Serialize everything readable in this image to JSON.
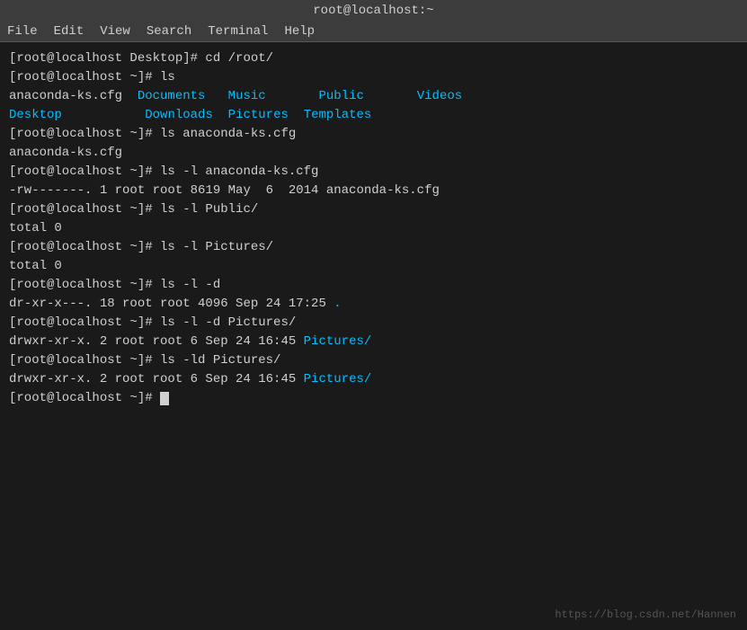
{
  "titleBar": {
    "title": "root@localhost:~"
  },
  "menuBar": {
    "items": [
      "File",
      "Edit",
      "View",
      "Search",
      "Terminal",
      "Help"
    ]
  },
  "terminal": {
    "lines": [
      {
        "type": "command",
        "text": "[root@localhost Desktop]# cd /root/"
      },
      {
        "type": "command",
        "text": "[root@localhost ~]# ls"
      },
      {
        "type": "ls_output_1",
        "parts": [
          {
            "text": "anaconda-ks.cfg  ",
            "color": "white"
          },
          {
            "text": "Documents",
            "color": "cyan"
          },
          {
            "text": "   ",
            "color": "white"
          },
          {
            "text": "Music",
            "color": "cyan"
          },
          {
            "text": "       ",
            "color": "white"
          },
          {
            "text": "Public",
            "color": "cyan"
          },
          {
            "text": "       ",
            "color": "white"
          },
          {
            "text": "Videos",
            "color": "cyan"
          }
        ]
      },
      {
        "type": "ls_output_2",
        "parts": [
          {
            "text": "Desktop",
            "color": "cyan"
          },
          {
            "text": "           ",
            "color": "white"
          },
          {
            "text": "Downloads",
            "color": "cyan"
          },
          {
            "text": "  ",
            "color": "white"
          },
          {
            "text": "Pictures",
            "color": "cyan"
          },
          {
            "text": "  ",
            "color": "white"
          },
          {
            "text": "Templates",
            "color": "cyan"
          }
        ]
      },
      {
        "type": "command",
        "text": "[root@localhost ~]# ls anaconda-ks.cfg"
      },
      {
        "type": "output",
        "text": "anaconda-ks.cfg"
      },
      {
        "type": "command",
        "text": "[root@localhost ~]# ls -l anaconda-ks.cfg"
      },
      {
        "type": "output",
        "text": "-rw-------. 1 root root 8619 May  6  2014 anaconda-ks.cfg"
      },
      {
        "type": "command",
        "text": "[root@localhost ~]# ls -l Public/"
      },
      {
        "type": "output",
        "text": "total 0"
      },
      {
        "type": "command",
        "text": "[root@localhost ~]# ls -l Pictures/"
      },
      {
        "type": "output",
        "text": "total 0"
      },
      {
        "type": "command",
        "text": "[root@localhost ~]# ls -l -d"
      },
      {
        "type": "ls_dot",
        "parts": [
          {
            "text": "dr-xr-x---. 18 root root 4096 Sep 24 17:25 ",
            "color": "white"
          },
          {
            "text": ".",
            "color": "cyan"
          }
        ]
      },
      {
        "type": "command",
        "text": "[root@localhost ~]# ls -l -d Pictures/"
      },
      {
        "type": "ls_pics",
        "parts": [
          {
            "text": "drwxr-xr-x. 2 root root 6 Sep 24 16:45 ",
            "color": "white"
          },
          {
            "text": "Pictures/",
            "color": "cyan"
          }
        ]
      },
      {
        "type": "command",
        "text": "[root@localhost ~]# ls -ld Pictures/"
      },
      {
        "type": "ls_pics2",
        "parts": [
          {
            "text": "drwxr-xr-x. 2 root root 6 Sep 24 16:45 ",
            "color": "white"
          },
          {
            "text": "Pictures/",
            "color": "cyan"
          }
        ]
      },
      {
        "type": "prompt",
        "text": "[root@localhost ~]# "
      }
    ],
    "watermark": "https://blog.csdn.net/Hannen"
  }
}
